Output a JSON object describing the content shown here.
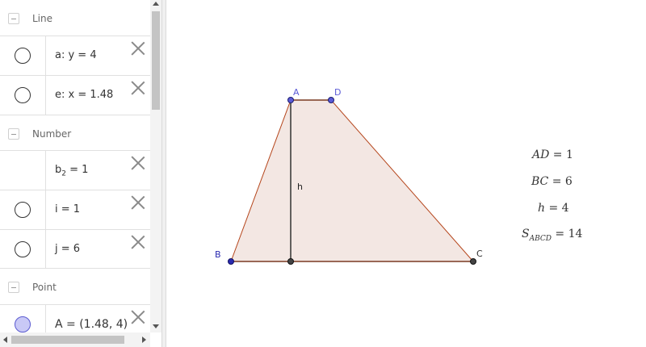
{
  "algebra": {
    "groups": {
      "line": "Line",
      "number": "Number",
      "point": "Point"
    },
    "rows": {
      "a": "a: y = 4",
      "e": "e: x = 1.48",
      "b2_name": "b",
      "b2_sub": "2",
      "b2_value": " = 1",
      "i": "i = 1",
      "j": "j = 6",
      "A": "A = (1.48, 4)"
    }
  },
  "graphics": {
    "points": {
      "A": "A",
      "D": "D",
      "B": "B",
      "C": "C"
    },
    "height_label": "h",
    "results": {
      "ad_lhs": "AD",
      "ad_rhs": " = 1",
      "bc_lhs": "BC",
      "bc_rhs": " = 6",
      "h_lhs": "h",
      "h_rhs": " = 4",
      "s_lhs": "S",
      "s_sub": "ABCD",
      "s_rhs": " = 14"
    }
  },
  "colors": {
    "polygon_fill": "#f3e7e3",
    "polygon_edge": "#b5451b",
    "point_blue": "#5b5bd6",
    "height_line": "#333333"
  }
}
